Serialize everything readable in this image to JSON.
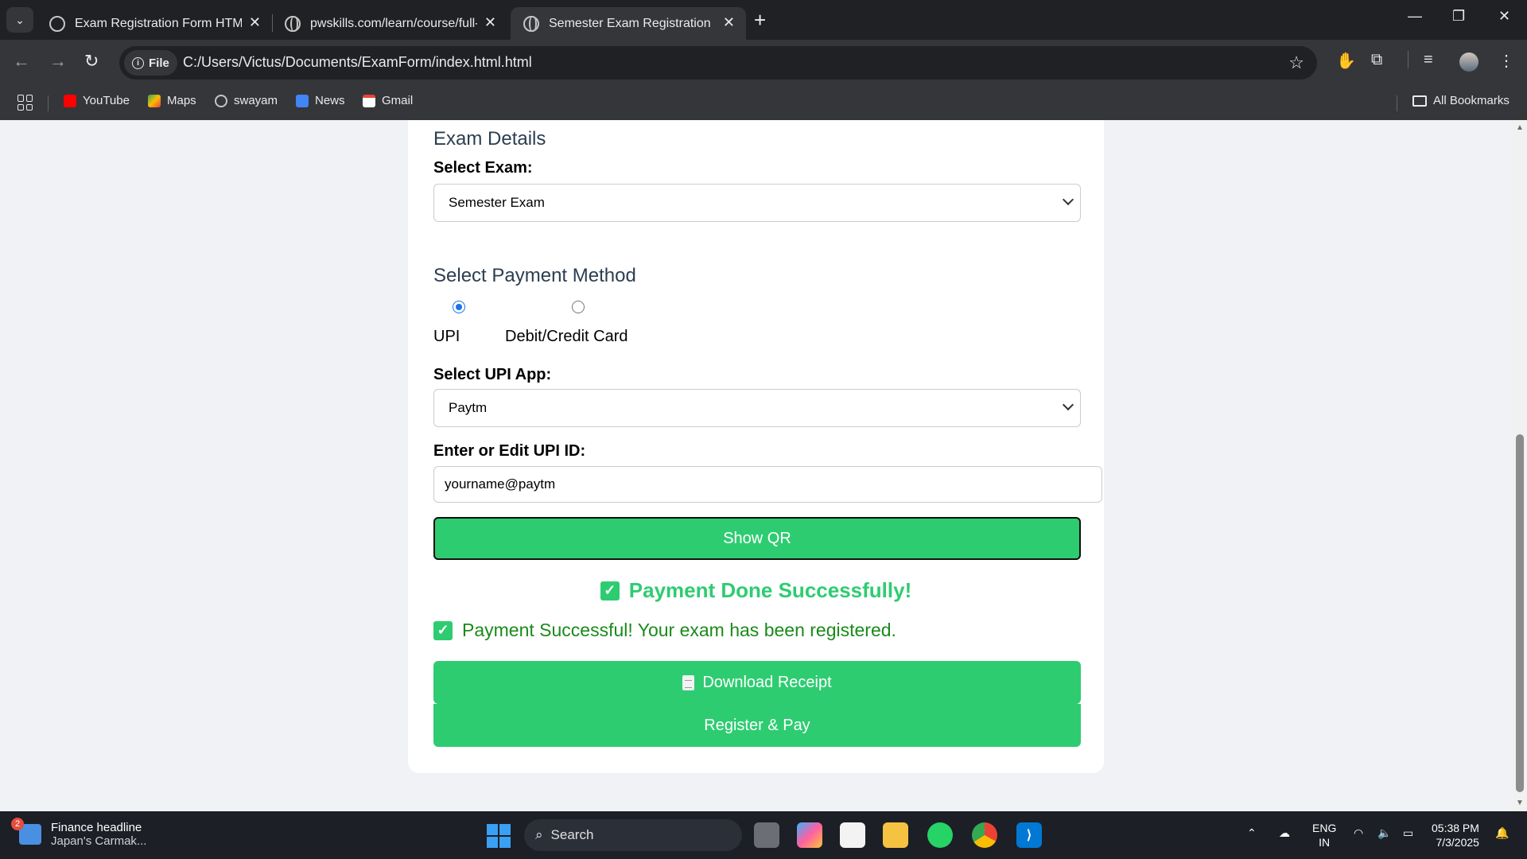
{
  "browser": {
    "tabs": [
      {
        "title": "Exam Registration Form HTML",
        "active": false
      },
      {
        "title": "pwskills.com/learn/course/full-s",
        "active": false
      },
      {
        "title": "Semester Exam Registration",
        "active": true
      }
    ],
    "address_chip": "File",
    "url": "C:/Users/Victus/Documents/ExamForm/index.html.html",
    "bookmarks": [
      "YouTube",
      "Maps",
      "swayam",
      "News",
      "Gmail"
    ],
    "all_bookmarks": "All Bookmarks"
  },
  "form": {
    "exam_section_title": "Exam Details",
    "select_exam_label": "Select Exam:",
    "selected_exam": "Semester Exam",
    "payment_section_title": "Select Payment Method",
    "payment_methods": [
      {
        "label": "UPI",
        "checked": true
      },
      {
        "label": "Debit/Credit Card",
        "checked": false
      }
    ],
    "upi_app_label": "Select UPI App:",
    "selected_upi_app": "Paytm",
    "upi_id_label": "Enter or Edit UPI ID:",
    "upi_id_value": "yourname@paytm",
    "show_qr_button": "Show QR",
    "payment_done": "Payment Done Successfully!",
    "registered_message": "Payment Successful! Your exam has been registered.",
    "download_receipt_button": "Download Receipt",
    "register_pay_button": "Register & Pay",
    "accent_color": "#2ecc71"
  },
  "taskbar": {
    "news_badge": "2",
    "news_headline": "Finance headline",
    "news_sub": "Japan's Carmak...",
    "search_label": "Search",
    "lang_top": "ENG",
    "lang_bottom": "IN",
    "time": "05:38 PM",
    "date": "7/3/2025"
  }
}
